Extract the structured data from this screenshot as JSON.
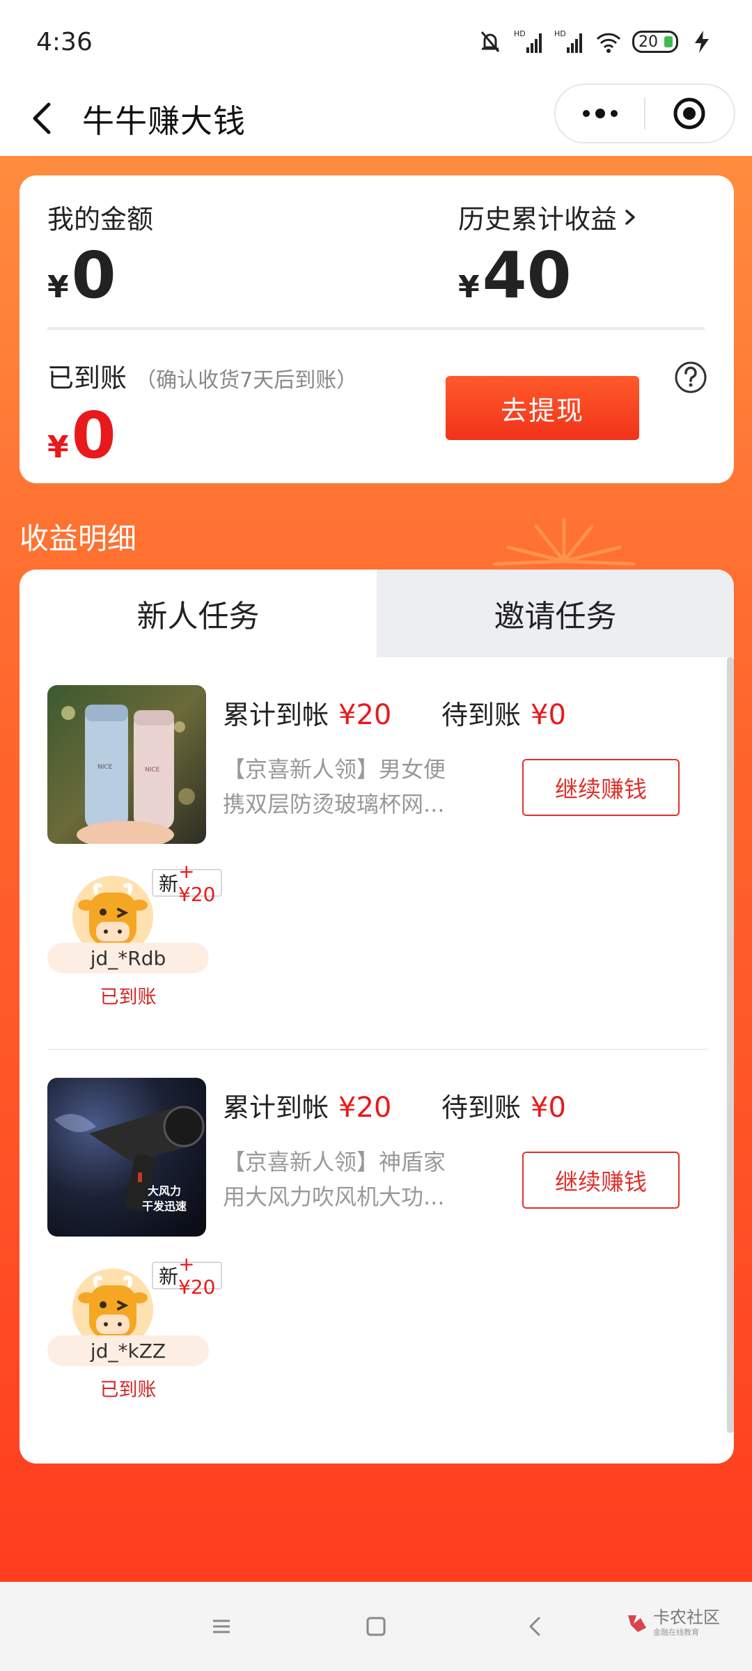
{
  "status_bar": {
    "time": "4:36",
    "battery": "20"
  },
  "nav": {
    "title": "牛牛赚大钱"
  },
  "summary": {
    "my_amount_label": "我的金额",
    "my_amount_currency": "¥",
    "my_amount_value": "0",
    "history_label": "历史累计收益",
    "history_currency": "¥",
    "history_value": "40",
    "arrived_label": "已到账",
    "arrived_note": "（确认收货7天后到账）",
    "arrived_currency": "¥",
    "arrived_value": "0",
    "withdraw_button": "去提现"
  },
  "section": {
    "title": "收益明细"
  },
  "tabs": [
    {
      "label": "新人任务",
      "active": true
    },
    {
      "label": "邀请任务",
      "active": false
    }
  ],
  "tasks": [
    {
      "accum_label": "累计到帐",
      "accum_value": "¥20",
      "pending_label": "待到账",
      "pending_value": "¥0",
      "description": "【京喜新人领】男女便携双层防烫玻璃杯网...",
      "button": "继续赚钱",
      "badge_new": "新",
      "badge_amount": "+¥20",
      "user": "jd_*Rdb",
      "status": "已到账"
    },
    {
      "accum_label": "累计到帐",
      "accum_value": "¥20",
      "pending_label": "待到账",
      "pending_value": "¥0",
      "description": "【京喜新人领】神盾家用大风力吹风机大功...",
      "button": "继续赚钱",
      "badge_new": "新",
      "badge_amount": "+¥20",
      "user": "jd_*kZZ",
      "status": "已到账",
      "image_text_1": "大风力",
      "image_text_2": "干发迅速"
    }
  ],
  "watermark": {
    "text": "卡农社区",
    "sub": "金融在线教育"
  },
  "colors": {
    "accent": "#ff5a2b",
    "red": "#e8191c",
    "tab_inactive": "#eceef2"
  }
}
